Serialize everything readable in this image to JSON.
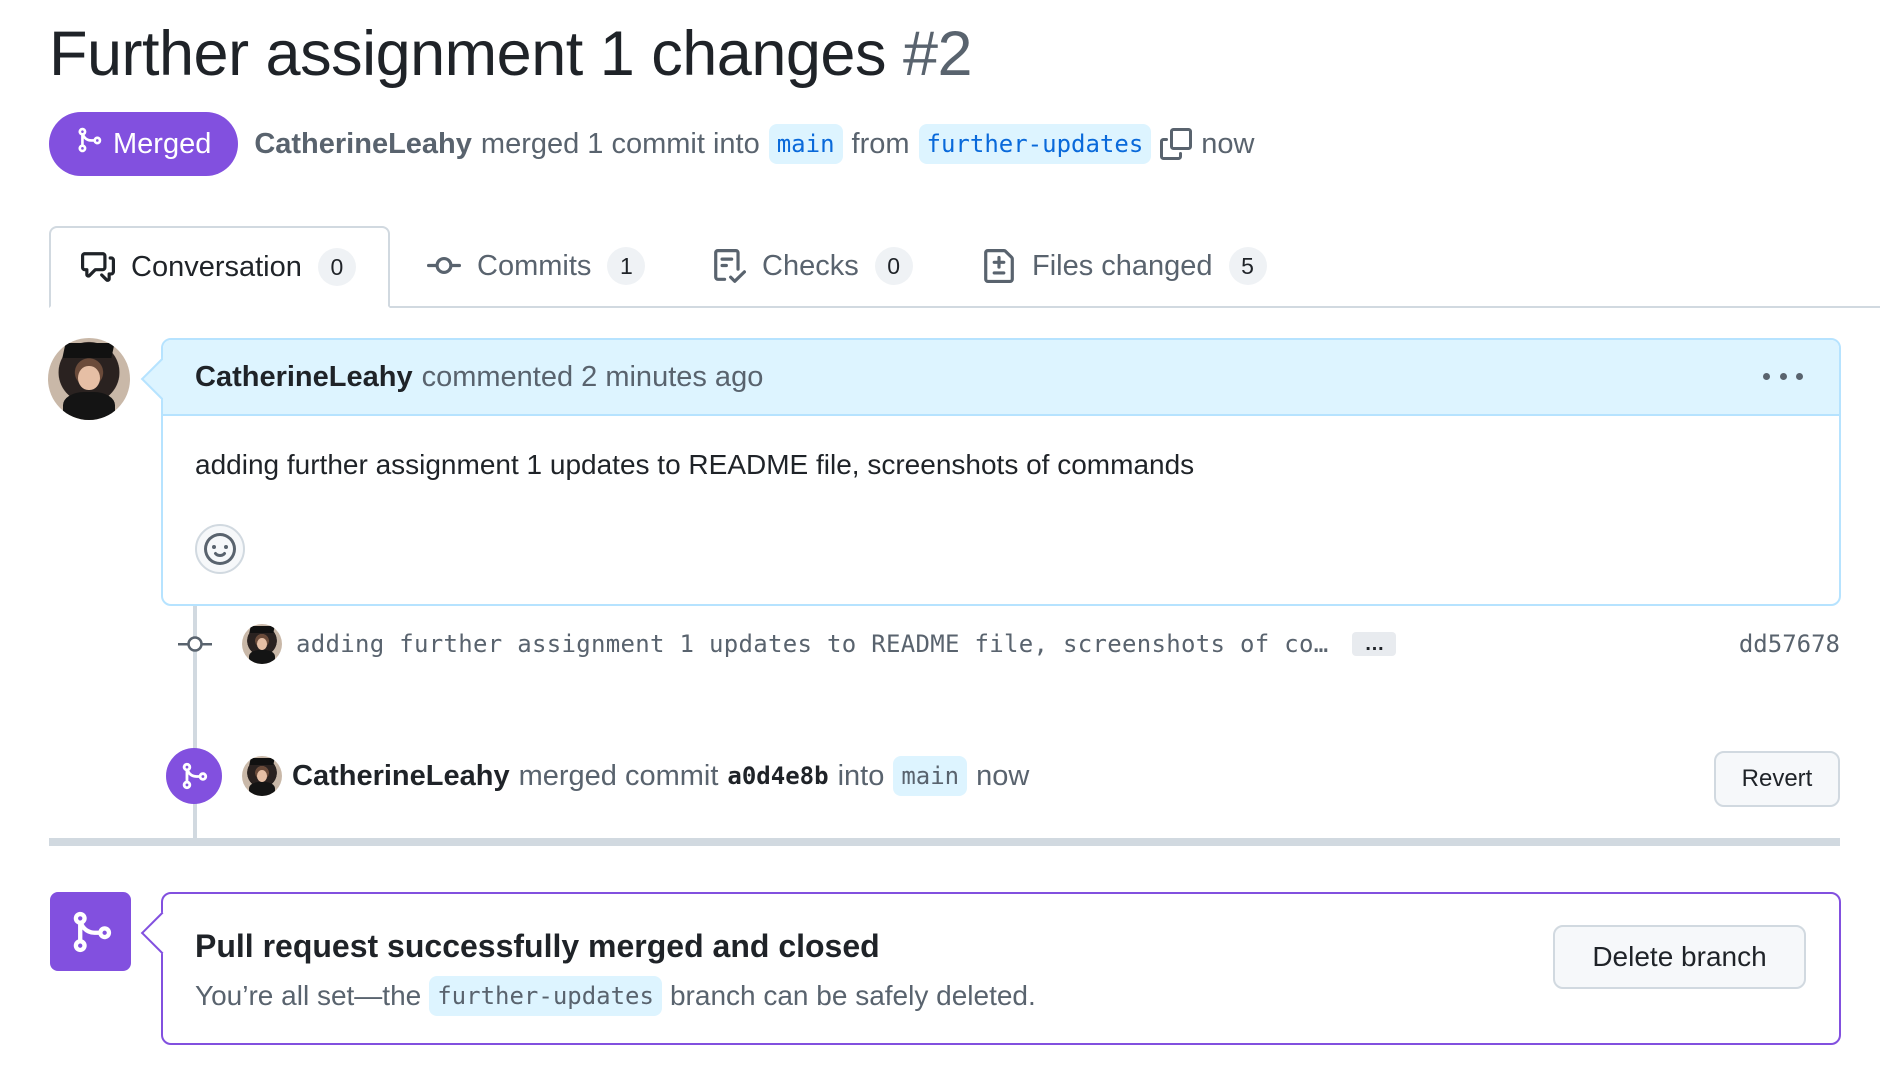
{
  "pr": {
    "title": "Further assignment 1 changes",
    "number": "#2",
    "state_label": "Merged",
    "author": "CatherineLeahy",
    "merge_summary": "merged 1 commit into",
    "base_branch": "main",
    "from_word": "from",
    "head_branch": "further-updates",
    "time": "now"
  },
  "tabs": [
    {
      "label": "Conversation",
      "count": "0",
      "icon": "comment-discussion-icon"
    },
    {
      "label": "Commits",
      "count": "1",
      "icon": "git-commit-icon"
    },
    {
      "label": "Checks",
      "count": "0",
      "icon": "checklist-icon"
    },
    {
      "label": "Files changed",
      "count": "5",
      "icon": "file-diff-icon"
    }
  ],
  "comment": {
    "author": "CatherineLeahy",
    "action": "commented 2 minutes ago",
    "body": "adding further assignment 1 updates to README file, screenshots of commands"
  },
  "commit": {
    "message": "adding further assignment 1 updates to README file, screenshots of co…",
    "expand_label": "…",
    "sha": "dd57678"
  },
  "merge_event": {
    "author": "CatherineLeahy",
    "action": "merged commit",
    "sha": "a0d4e8b",
    "into_word": "into",
    "branch": "main",
    "time": "now",
    "revert_label": "Revert"
  },
  "merged_box": {
    "title": "Pull request successfully merged and closed",
    "sub_before": "You’re all set—the",
    "branch": "further-updates",
    "sub_after": "branch can be safely deleted.",
    "delete_label": "Delete branch"
  },
  "colors": {
    "merged_purple": "#8250df",
    "comment_header_bg": "#ddf4ff",
    "branch_text": "#0969da"
  }
}
